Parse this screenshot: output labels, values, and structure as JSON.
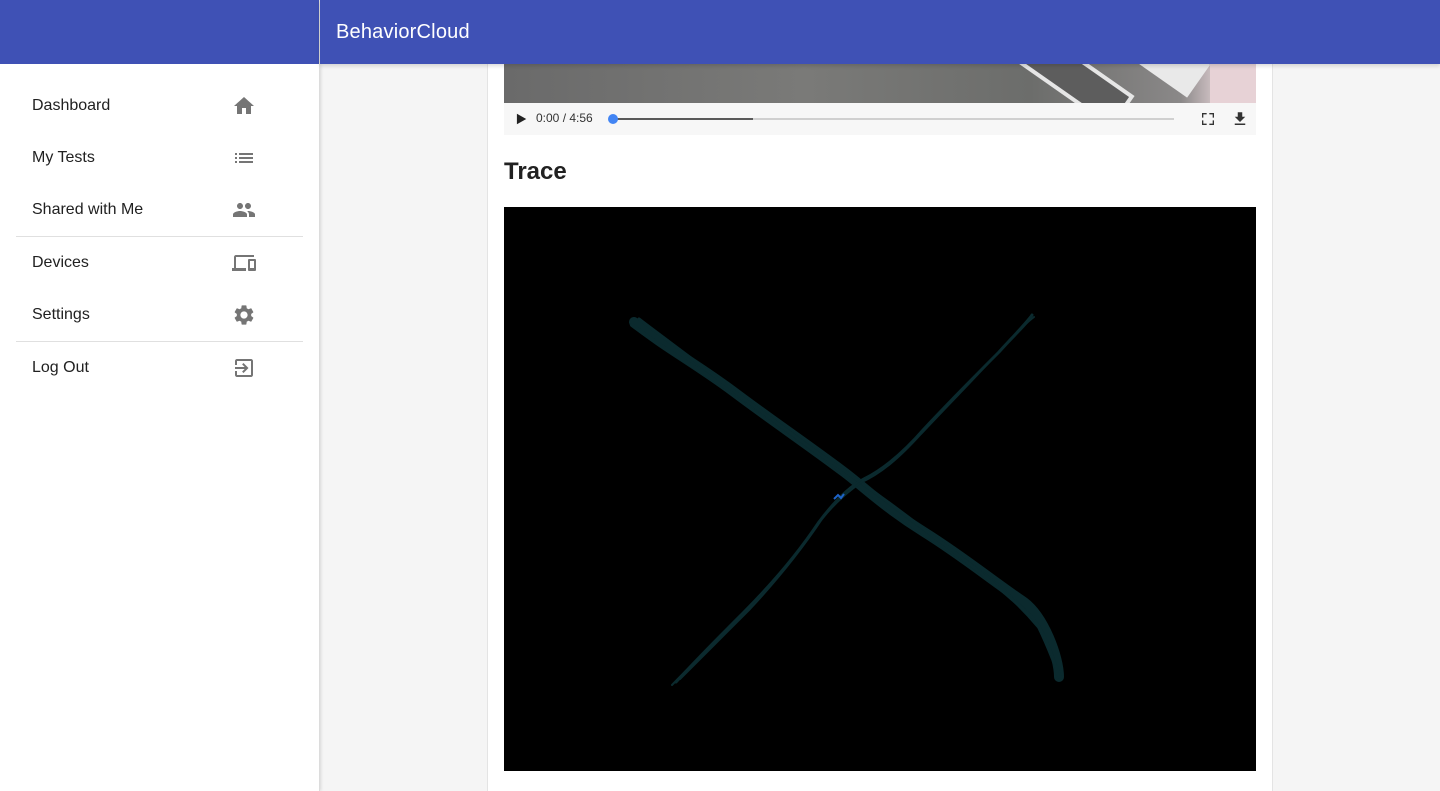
{
  "app": {
    "title": "BehaviorCloud",
    "brand_color": "#3f51b5"
  },
  "sidebar": {
    "groups": [
      [
        {
          "label": "Dashboard",
          "icon": "home-icon"
        },
        {
          "label": "My Tests",
          "icon": "list-icon"
        },
        {
          "label": "Shared with Me",
          "icon": "people-icon"
        }
      ],
      [
        {
          "label": "Devices",
          "icon": "devices-icon"
        },
        {
          "label": "Settings",
          "icon": "gear-icon"
        }
      ],
      [
        {
          "label": "Log Out",
          "icon": "exit-icon"
        }
      ]
    ]
  },
  "video": {
    "time_display": "0:00 / 4:56",
    "played_fraction": 0,
    "buffered_fraction": 0.25,
    "controls": [
      "play-icon",
      "fullscreen-icon",
      "download-icon"
    ]
  },
  "trace": {
    "heading": "Trace",
    "background": "#000000",
    "path_color": "#0b2a2e",
    "marker_color": "#1e63c8"
  }
}
